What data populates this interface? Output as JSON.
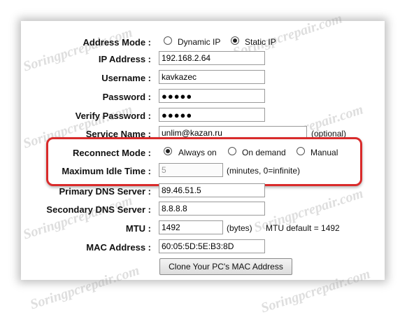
{
  "watermark": "Soringpcrepair.com",
  "address_mode": {
    "label": "Address Mode :",
    "options": [
      {
        "label": "Dynamic IP",
        "checked": false
      },
      {
        "label": "Static IP",
        "checked": true
      }
    ]
  },
  "ip_address": {
    "label": "IP Address :",
    "value": "192.168.2.64"
  },
  "username": {
    "label": "Username :",
    "value": "kavkazec"
  },
  "password": {
    "label": "Password :",
    "value": "●●●●●"
  },
  "verify_password": {
    "label": "Verify Password :",
    "value": "●●●●●"
  },
  "service_name": {
    "label": "Service Name :",
    "value": "unlim@kazan.ru",
    "note": "(optional)"
  },
  "reconnect_mode": {
    "label": "Reconnect Mode :",
    "options": [
      {
        "label": "Always on",
        "checked": true
      },
      {
        "label": "On demand",
        "checked": false
      },
      {
        "label": "Manual",
        "checked": false
      }
    ]
  },
  "max_idle_time": {
    "label": "Maximum Idle Time :",
    "value": "5",
    "note": "(minutes, 0=infinite)"
  },
  "primary_dns": {
    "label": "Primary DNS Server :",
    "value": "89.46.51.5"
  },
  "secondary_dns": {
    "label": "Secondary DNS Server :",
    "value": "8.8.8.8"
  },
  "mtu": {
    "label": "MTU :",
    "value": "1492",
    "unit": "(bytes)",
    "default_note": "MTU default = 1492"
  },
  "mac_address": {
    "label": "MAC Address :",
    "value": "60:05:5D:5E:B3:8D"
  },
  "clone_button": {
    "label": "Clone Your PC's MAC Address"
  },
  "colors": {
    "highlight": "#d92b2b"
  }
}
